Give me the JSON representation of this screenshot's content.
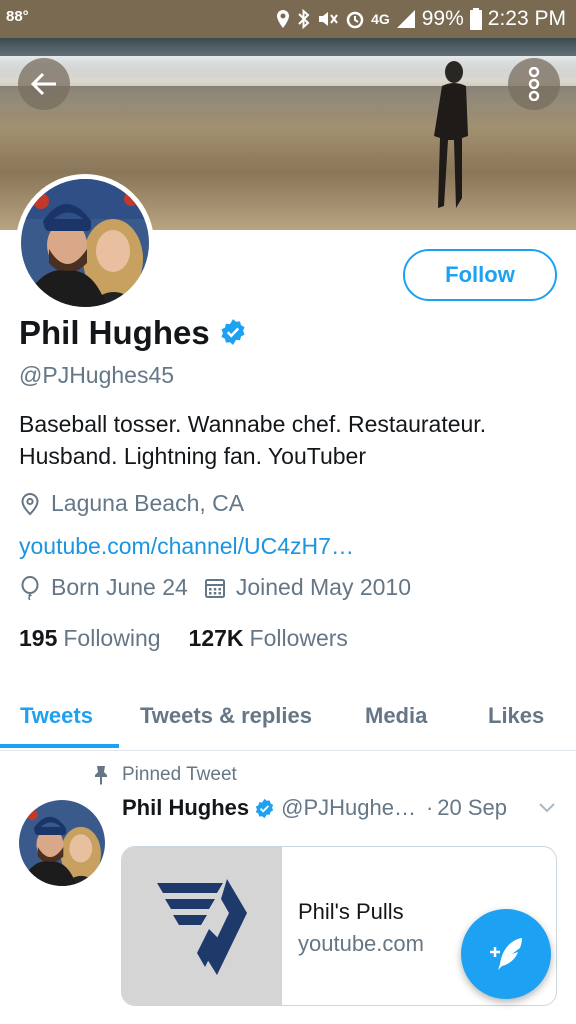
{
  "status_bar": {
    "temperature": "88°",
    "network": "4G",
    "battery": "99%",
    "time": "2:23 PM"
  },
  "profile": {
    "name": "Phil Hughes",
    "handle": "@PJHughes45",
    "bio": "Baseball tosser. Wannabe chef. Restaurateur. Husband. Lightning fan. YouTuber",
    "location": "Laguna Beach, CA",
    "website": "youtube.com/channel/UC4zH7…",
    "birthday": "Born June 24",
    "joined": "Joined May 2010",
    "following_count": "195",
    "following_label": "Following",
    "followers_count": "127K",
    "followers_label": "Followers",
    "follow_button": "Follow"
  },
  "tabs": [
    {
      "label": "Tweets",
      "active": true
    },
    {
      "label": "Tweets & replies",
      "active": false
    },
    {
      "label": "Media",
      "active": false
    },
    {
      "label": "Likes",
      "active": false
    }
  ],
  "tweet": {
    "pinned_label": "Pinned Tweet",
    "author_name": "Phil Hughes",
    "author_handle": "@PJHughe…",
    "separator": "·",
    "date": "20 Sep",
    "card_title": "Phil's Pulls",
    "card_domain": "youtube.com"
  },
  "colors": {
    "accent": "#1da1f2",
    "link": "#1b95e0",
    "text_primary": "#14171a",
    "text_secondary": "#657786"
  },
  "icons": {
    "back": "arrow-left-icon",
    "more": "more-vertical-icon",
    "verified": "verified-badge-icon",
    "location": "location-pin-icon",
    "birthday": "balloon-icon",
    "calendar": "calendar-icon",
    "pin": "pushpin-icon",
    "compose": "compose-tweet-icon"
  }
}
